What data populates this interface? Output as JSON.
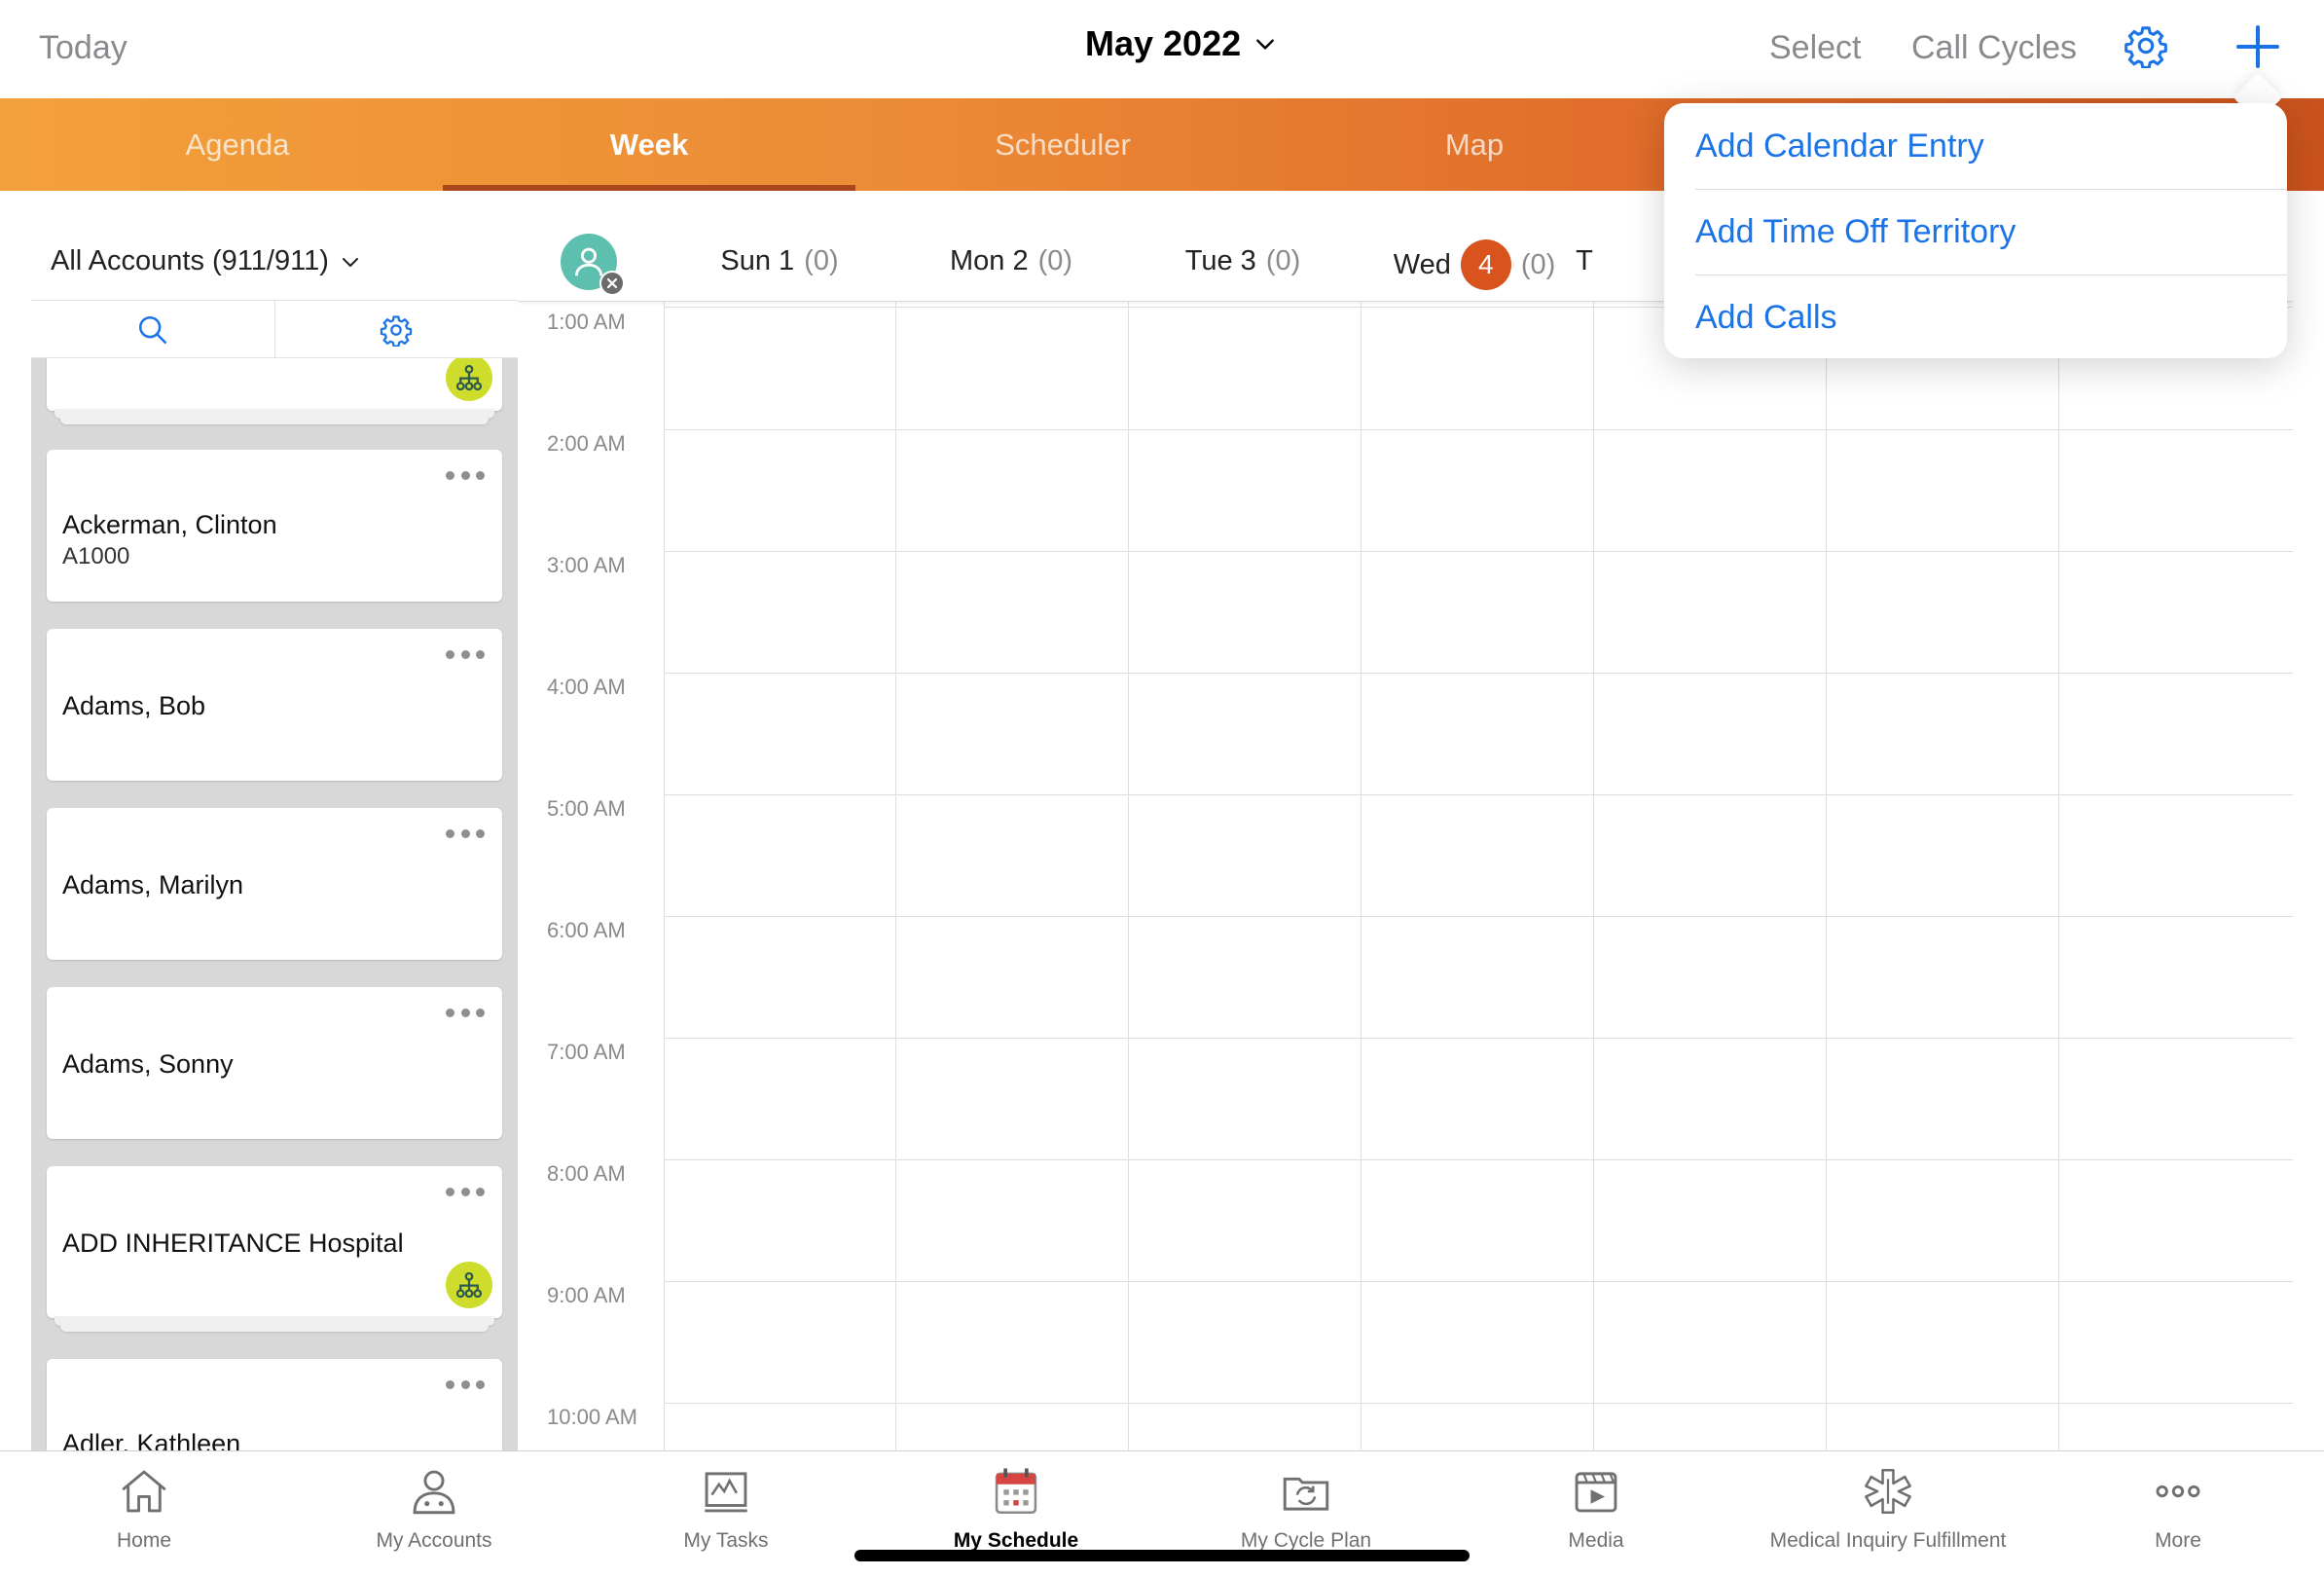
{
  "topbar": {
    "today_label": "Today",
    "month_label": "May 2022",
    "select_label": "Select",
    "call_cycles_label": "Call Cycles"
  },
  "tabs": [
    {
      "label": "Agenda",
      "active": false
    },
    {
      "label": "Week",
      "active": true
    },
    {
      "label": "Scheduler",
      "active": false
    },
    {
      "label": "Map",
      "active": false
    }
  ],
  "left_panel": {
    "filter_label": "All Accounts (911/911)",
    "accounts": [
      {
        "name": "",
        "sub": "",
        "has_hierarchy_badge": true
      },
      {
        "name": "Ackerman, Clinton",
        "sub": "A1000",
        "has_hierarchy_badge": false
      },
      {
        "name": "Adams, Bob",
        "sub": "",
        "has_hierarchy_badge": false
      },
      {
        "name": "Adams, Marilyn",
        "sub": "",
        "has_hierarchy_badge": false
      },
      {
        "name": "Adams, Sonny",
        "sub": "",
        "has_hierarchy_badge": false
      },
      {
        "name": "ADD INHERITANCE Hospital",
        "sub": "",
        "has_hierarchy_badge": true
      },
      {
        "name": "Adler, Kathleen",
        "sub": "",
        "has_hierarchy_badge": false
      }
    ]
  },
  "calendar": {
    "days": [
      {
        "label": "Sun 1",
        "count": "(0)",
        "today": false
      },
      {
        "label": "Mon 2",
        "count": "(0)",
        "today": false
      },
      {
        "label": "Tue 3",
        "count": "(0)",
        "today": false
      },
      {
        "label": "Wed",
        "day_num": "4",
        "count": "(0)",
        "today": true
      },
      {
        "label": "T",
        "count": "",
        "today": false
      }
    ],
    "hours": [
      "1:00 AM",
      "2:00 AM",
      "3:00 AM",
      "4:00 AM",
      "5:00 AM",
      "6:00 AM",
      "7:00 AM",
      "8:00 AM",
      "9:00 AM",
      "10:00 AM"
    ]
  },
  "add_menu": {
    "items": [
      "Add Calendar Entry",
      "Add Time Off Territory",
      "Add Calls"
    ]
  },
  "bottom_nav": {
    "items": [
      {
        "label": "Home",
        "icon": "home-icon",
        "active": false
      },
      {
        "label": "My Accounts",
        "icon": "accounts-icon",
        "active": false
      },
      {
        "label": "My Tasks",
        "icon": "tasks-icon",
        "active": false
      },
      {
        "label": "My Schedule",
        "icon": "calendar-icon",
        "active": true
      },
      {
        "label": "My Cycle Plan",
        "icon": "cycle-plan-icon",
        "active": false
      },
      {
        "label": "Media",
        "icon": "media-icon",
        "active": false
      },
      {
        "label": "Medical Inquiry Fulfillment",
        "icon": "medical-icon",
        "active": false
      },
      {
        "label": "More",
        "icon": "more-icon",
        "active": false
      }
    ]
  },
  "colors": {
    "accent_blue": "#1b73e8",
    "tab_orange_start": "#f2a03c",
    "tab_orange_end": "#c9521d",
    "today_badge": "#d9531e",
    "hierarchy_badge": "#cedd2c"
  }
}
